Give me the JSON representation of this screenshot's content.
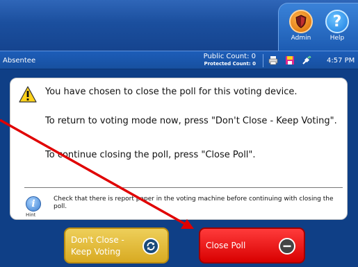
{
  "header": {
    "admin_label": "Admin",
    "help_label": "Help",
    "help_glyph": "?"
  },
  "statusbar": {
    "mode": "Absentee",
    "public_count": "Public Count: 0",
    "protected_count": "Protected Count: 0",
    "time": "4:57 PM"
  },
  "dialog": {
    "message1": "You have chosen to close the poll for this voting device.",
    "message2": "To return to voting mode now, press \"Don't Close - Keep Voting\".",
    "message3": "To continue closing the poll, press \"Close Poll\".",
    "hint_text": "Check that there is report paper in the voting machine before continuing with closing the poll.",
    "hint_label": "Hint",
    "hint_glyph": "i"
  },
  "buttons": {
    "keep_voting_line1": "Don't Close -",
    "keep_voting_line2": "Keep Voting",
    "close_poll": "Close Poll"
  },
  "colors": {
    "background": "#0f3f86",
    "keep_button": "#d8aa22",
    "close_button": "#e00000",
    "annotation_arrow": "#e00000"
  },
  "icons": [
    "shield-icon",
    "help-icon",
    "printer-icon",
    "disk-icon",
    "power-plug-icon",
    "warning-icon",
    "hint-icon",
    "refresh-icon",
    "minus-circle-icon"
  ]
}
